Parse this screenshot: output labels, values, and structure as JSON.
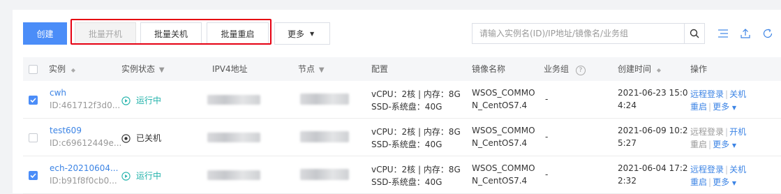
{
  "toolbar": {
    "create_label": "创建",
    "batch_start_label": "批量开机",
    "batch_stop_label": "批量关机",
    "batch_restart_label": "批量重启",
    "more_label": "更多"
  },
  "search": {
    "placeholder": "请输入实例名(ID)/IP地址/镜像名/业务组"
  },
  "icons": {
    "search": "search-icon",
    "columns": "column-settings-icon",
    "export": "export-icon",
    "refresh": "refresh-icon"
  },
  "table": {
    "headers": {
      "instance": "实例",
      "status": "实例状态",
      "ipv4": "IPV4地址",
      "node": "节点",
      "config": "配置",
      "image": "镜像名称",
      "group": "业务组",
      "created": "创建时间",
      "actions": "操作"
    },
    "rows": [
      {
        "name": "cwh",
        "id": "ID:461712f3d0...",
        "status": "运行中",
        "checked": true,
        "config_line1": "vCPU：2核 | 内存：8G",
        "config_line2": "SSD-系统盘：40G",
        "image_line1": "WSOS_COMMO",
        "image_line2": "N_CentOS7.4",
        "group": "-",
        "created_line1": "2021-06-23 15:0",
        "created_line2": "4:24",
        "action_login": "远程登录",
        "action_power": "关机",
        "action_restart": "重启",
        "action_more": "更多"
      },
      {
        "name": "test609",
        "id": "ID:c69612449e...",
        "status": "已关机",
        "checked": false,
        "config_line1": "vCPU：2核 | 内存：8G",
        "config_line2": "SSD-系统盘：40G",
        "image_line1": "WSOS_COMMO",
        "image_line2": "N_CentOS7.4",
        "group": "-",
        "created_line1": "2021-06-09 10:2",
        "created_line2": "5:27",
        "action_login": "远程登录",
        "action_power": "开机",
        "action_restart": "重启",
        "action_more": "更多"
      },
      {
        "name": "ech-20210604...",
        "id": "ID:b91f8f0cb0...",
        "status": "运行中",
        "checked": true,
        "config_line1": "vCPU：2核 | 内存：8G",
        "config_line2": "SSD-系统盘：40G",
        "image_line1": "WSOS_COMMO",
        "image_line2": "N_CentOS7.4",
        "group": "-",
        "created_line1": "2021-06-04 17:2",
        "created_line2": "2:32",
        "action_login": "远程登录",
        "action_power": "关机",
        "action_restart": "重启",
        "action_more": "更多"
      }
    ]
  },
  "colors": {
    "primary": "#4b8df8",
    "link": "#3c84e5",
    "running": "#20b2aa",
    "highlight": "#e60012"
  }
}
